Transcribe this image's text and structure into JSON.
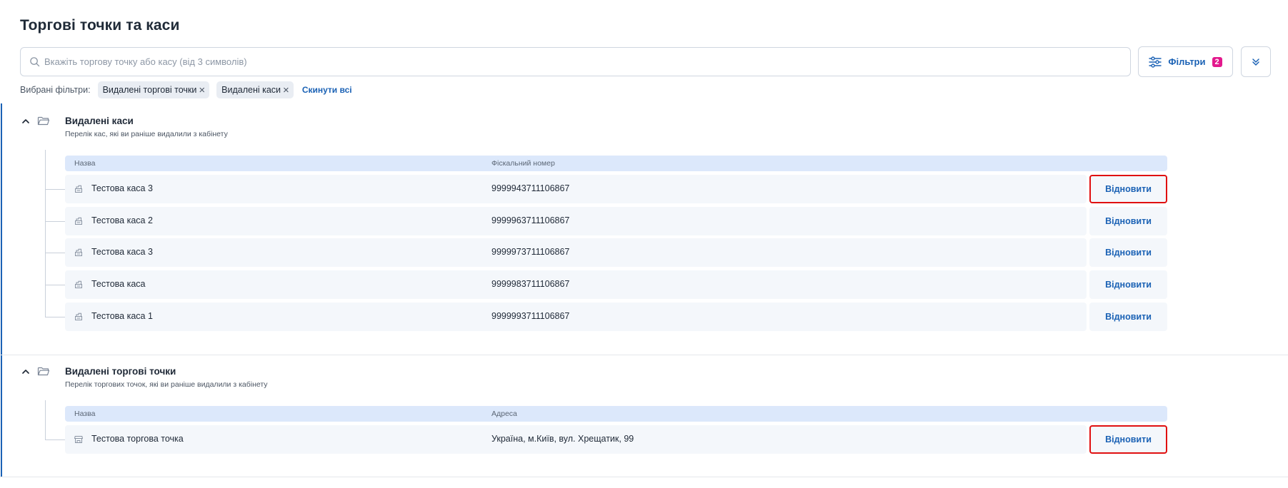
{
  "page": {
    "title": "Торгові точки та каси"
  },
  "search": {
    "placeholder": "Вкажіть торгову точку або касу (від 3 символів)"
  },
  "filters_button": {
    "label": "Фільтри",
    "count": "2"
  },
  "chosen_filters": {
    "label": "Вибрані фільтри:",
    "chips": [
      "Видалені торгові точки",
      "Видалені каси"
    ],
    "reset_label": "Скинути всі"
  },
  "deleted_registers": {
    "title": "Видалені каси",
    "subtitle": "Перелік кас, які ви раніше видалили з кабінету",
    "col_name": "Назва",
    "col_fiscal": "Фіскальний номер",
    "rows": [
      {
        "name": "Тестова каса 3",
        "fiscal": "9999943711106867",
        "action": "Відновити"
      },
      {
        "name": "Тестова каса 2",
        "fiscal": "9999963711106867",
        "action": "Відновити"
      },
      {
        "name": "Тестова каса 3",
        "fiscal": "9999973711106867",
        "action": "Відновити"
      },
      {
        "name": "Тестова каса",
        "fiscal": "9999983711106867",
        "action": "Відновити"
      },
      {
        "name": "Тестова каса 1",
        "fiscal": "9999993711106867",
        "action": "Відновити"
      }
    ]
  },
  "deleted_points": {
    "title": "Видалені торгові точки",
    "subtitle": "Перелік торгових точок, які ви раніше видалили з кабінету",
    "col_name": "Назва",
    "col_address": "Адреса",
    "rows": [
      {
        "name": "Тестова торгова точка",
        "address": "Україна, м.Київ, вул. Хрещатик, 99",
        "action": "Відновити"
      }
    ]
  },
  "colors": {
    "accent": "#1b62b5",
    "badge": "#e3198d",
    "highlight": "#e01010",
    "table_header": "#dce8fb",
    "row_bg": "#f4f7fb"
  }
}
